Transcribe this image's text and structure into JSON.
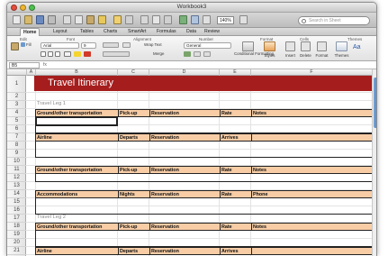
{
  "window": {
    "title": "Workbook3"
  },
  "toolbar": {
    "zoom": "140%",
    "search_placeholder": "Search in Sheet"
  },
  "tabs": [
    {
      "label": "Home",
      "active": true
    },
    {
      "label": "Layout"
    },
    {
      "label": "Tables"
    },
    {
      "label": "Charts"
    },
    {
      "label": "SmartArt"
    },
    {
      "label": "Formulas"
    },
    {
      "label": "Data"
    },
    {
      "label": "Review"
    }
  ],
  "ribbon": {
    "groups": {
      "edit": "Edit",
      "font": "Font",
      "alignment": "Alignment",
      "number": "Number",
      "format": "Format",
      "cells": "Cells",
      "themes": "Themes"
    },
    "fill_label": "Fill",
    "font_name": "Arial",
    "font_size": "9",
    "wrap_text": "Wrap Text",
    "number_format": "General",
    "merge_label": "Merge",
    "conditional_formatting": "Conditional Formatting",
    "styles": "Styles",
    "insert": "Insert",
    "delete": "Delete",
    "format": "Format",
    "themes": "Themes",
    "aa_label": "Aa"
  },
  "formula_bar": {
    "name_box": "B5",
    "fx": "fx"
  },
  "columns": [
    "A",
    "B",
    "C",
    "D",
    "E",
    "F"
  ],
  "rows": [
    "1",
    "2",
    "3",
    "4",
    "5",
    "6",
    "7",
    "8",
    "9",
    "10",
    "11",
    "12",
    "13",
    "14",
    "15",
    "16",
    "17",
    "18",
    "19",
    "20",
    "21",
    "22"
  ],
  "sheet": {
    "title": "Travel Itinerary",
    "leg1": "Travel Leg 1",
    "leg2": "Travel Leg 2",
    "ground_headers": [
      "Ground/other transportation",
      "Pick-up",
      "Reservation",
      "Rate",
      "Notes"
    ],
    "air_headers": [
      "Airline",
      "Departs",
      "Reservation",
      "Arrives"
    ],
    "accom_headers": [
      "Accommodations",
      "Nights",
      "Reservation",
      "Rate",
      "Phone"
    ]
  },
  "colors": {
    "banner": "#a51d1d",
    "header_fill": "#f8cda6",
    "scrollbar": "#4a84c8"
  }
}
